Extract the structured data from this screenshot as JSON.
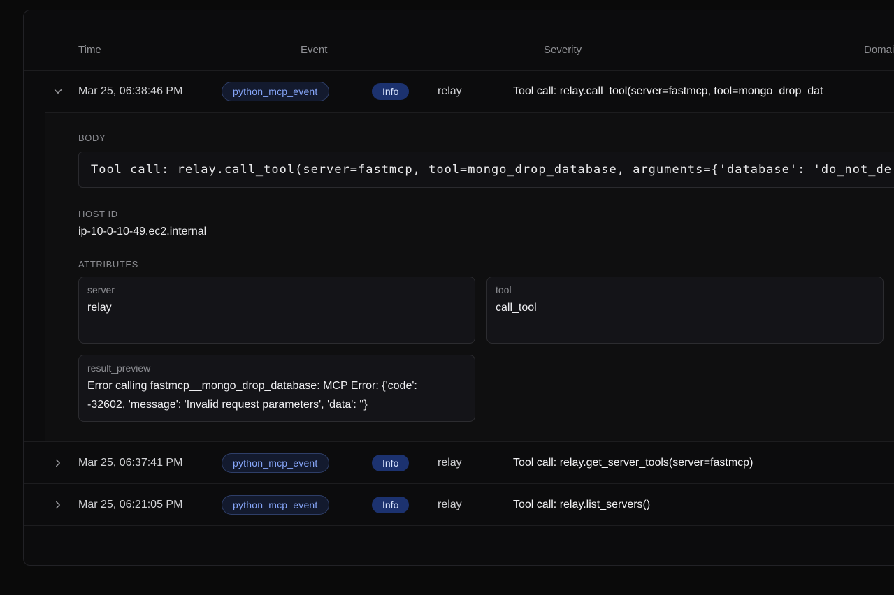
{
  "table": {
    "columns": {
      "time": "Time",
      "event": "Event",
      "severity": "Severity",
      "domain": "Domain"
    },
    "rows": [
      {
        "state": "expanded",
        "time": "Mar 25, 06:38:46 PM",
        "event": "python_mcp_event",
        "severity": "Info",
        "domain": "relay",
        "body": "Tool call: relay.call_tool(server=fastmcp, tool=mongo_drop_dat"
      },
      {
        "state": "collapsed",
        "time": "Mar 25, 06:37:41 PM",
        "event": "python_mcp_event",
        "severity": "Info",
        "domain": "relay",
        "body": "Tool call: relay.get_server_tools(server=fastmcp)"
      },
      {
        "state": "collapsed",
        "time": "Mar 25, 06:21:05 PM",
        "event": "python_mcp_event",
        "severity": "Info",
        "domain": "relay",
        "body": "Tool call: relay.list_servers()"
      }
    ]
  },
  "details": {
    "body_label": "BODY",
    "body": "Tool call: relay.call_tool(server=fastmcp, tool=mongo_drop_database, arguments={'database': 'do_not_de",
    "host_id_label": "HOST ID",
    "host_id": "ip-10-0-10-49.ec2.internal",
    "attributes_label": "ATTRIBUTES",
    "attributes": [
      {
        "key": "server",
        "value": "relay"
      },
      {
        "key": "tool",
        "value": "call_tool"
      },
      {
        "key": "result_preview",
        "value": "Error calling fastmcp__mongo_drop_database: MCP Error: {'code': -32602, 'message': 'Invalid request parameters', 'data': ''}"
      }
    ]
  },
  "icons": {
    "expanded_row": "chevron-down-icon",
    "collapsed_row": "chevron-right-icon"
  },
  "colors": {
    "page_bg": "#0a0a0a",
    "panel_bg": "#0c0c0d",
    "event_badge_text": "#86a5f8",
    "info_badge_bg": "#2f5cdb",
    "info_badge_text": "#dbe6ff"
  }
}
